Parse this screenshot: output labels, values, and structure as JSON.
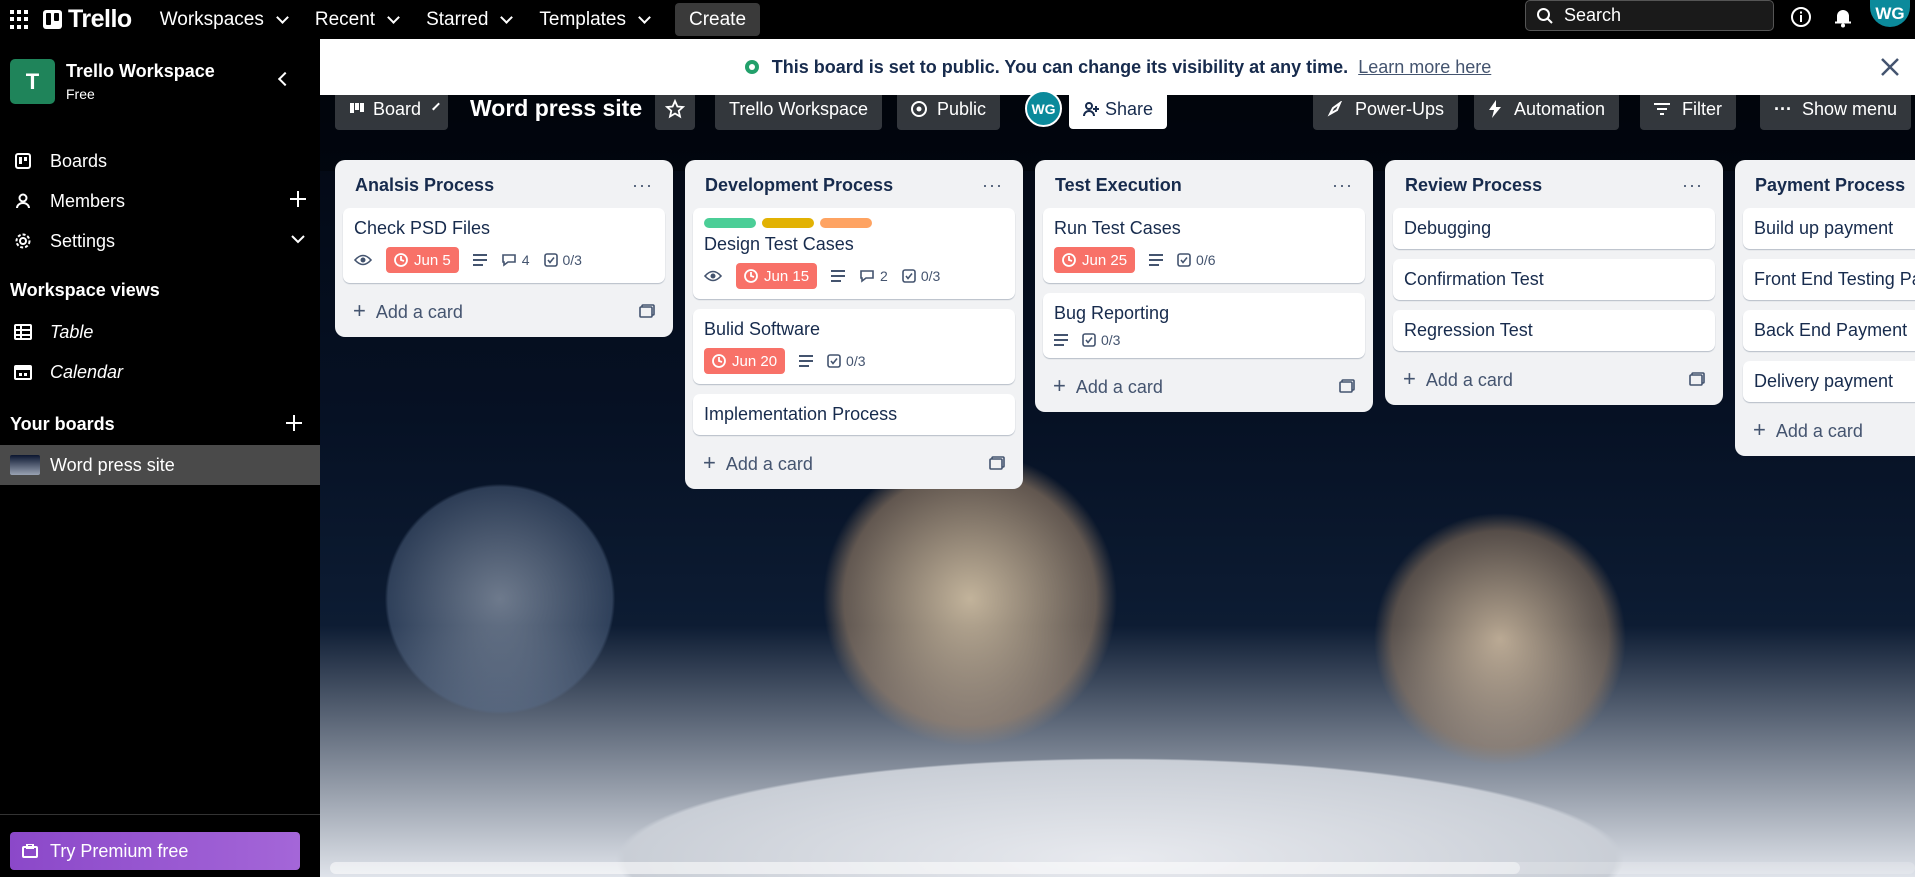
{
  "topbar": {
    "brand": "Trello",
    "nav": [
      "Workspaces",
      "Recent",
      "Starred",
      "Templates"
    ],
    "create_label": "Create",
    "search_placeholder": "Search",
    "avatar_initials": "WG"
  },
  "sidebar": {
    "workspace_name": "Trello Workspace",
    "workspace_plan": "Free",
    "workspace_initial": "T",
    "items": [
      {
        "label": "Boards"
      },
      {
        "label": "Members"
      },
      {
        "label": "Settings"
      }
    ],
    "views_heading": "Workspace views",
    "views": [
      {
        "label": "Table"
      },
      {
        "label": "Calendar"
      }
    ],
    "your_boards_heading": "Your boards",
    "boards": [
      {
        "label": "Word press site"
      }
    ],
    "premium_label": "Try Premium free"
  },
  "notice": {
    "message": "This board is set to public. You can change its visibility at any time.",
    "link": "Learn more here"
  },
  "boardbar": {
    "view_label": "Board",
    "title": "Word press site",
    "workspace_label": "Trello Workspace",
    "visibility_label": "Public",
    "member_initials": "WG",
    "share_label": "Share",
    "powerups_label": "Power-Ups",
    "automation_label": "Automation",
    "filter_label": "Filter",
    "menu_label": "Show menu"
  },
  "lists": [
    {
      "title": "Analsis Process",
      "cards": [
        {
          "title": "Check PSD Files",
          "due": "Jun 5",
          "comments": "4",
          "checklist": "0/3"
        }
      ],
      "add_label": "Add a card"
    },
    {
      "title": "Development Process",
      "cards": [
        {
          "title": "Design Test Cases",
          "due": "Jun 15",
          "comments": "2",
          "checklist": "0/3",
          "label_colors": [
            "#4bce97",
            "#e2b203",
            "#fea362"
          ]
        },
        {
          "title": "Bulid Software",
          "due": "Jun 20",
          "checklist": "0/3"
        },
        {
          "title": "Implementation Process"
        }
      ],
      "add_label": "Add a card"
    },
    {
      "title": "Test Execution",
      "cards": [
        {
          "title": "Run Test Cases",
          "due": "Jun 25",
          "checklist": "0/6"
        },
        {
          "title": "Bug Reporting",
          "checklist": "0/3"
        }
      ],
      "add_label": "Add a card"
    },
    {
      "title": "Review Process",
      "cards": [
        {
          "title": "Debugging"
        },
        {
          "title": "Confirmation Test"
        },
        {
          "title": "Regression Test"
        }
      ],
      "add_label": "Add a card"
    },
    {
      "title": "Payment Process",
      "cards": [
        {
          "title": "Build up payment"
        },
        {
          "title": "Front End Testing Pay"
        },
        {
          "title": "Back End Payment"
        },
        {
          "title": "Delivery payment"
        }
      ],
      "add_label": "Add a card"
    }
  ],
  "colors": {
    "due_badge": "#f87168",
    "premium": "#8b48c9",
    "workspace_logo": "#1f845a",
    "avatar": "#0b8a9b"
  }
}
